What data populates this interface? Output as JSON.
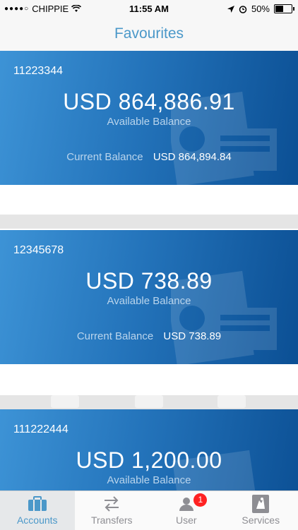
{
  "status_bar": {
    "carrier": "CHIPPIE",
    "time": "11:55 AM",
    "battery": "50%",
    "battery_level": 0.5
  },
  "nav": {
    "title": "Favourites"
  },
  "accounts": [
    {
      "number": "11223344",
      "available": "USD 864,886.91",
      "available_label": "Available Balance",
      "current_label": "Current Balance",
      "current": "USD 864,894.84"
    },
    {
      "number": "12345678",
      "available": "USD 738.89",
      "available_label": "Available Balance",
      "current_label": "Current Balance",
      "current": "USD 738.89"
    },
    {
      "number": "111222444",
      "available": "USD 1,200.00",
      "available_label": "Available Balance"
    }
  ],
  "tabs": [
    {
      "label": "Accounts",
      "icon": "briefcase-icon",
      "active": true
    },
    {
      "label": "Transfers",
      "icon": "transfer-arrows-icon"
    },
    {
      "label": "User",
      "icon": "user-icon",
      "badge": "1"
    },
    {
      "label": "Services",
      "icon": "services-icon"
    }
  ],
  "colors": {
    "accent": "#4b98c9",
    "card_start": "#3d93d6",
    "card_end": "#0b4f94",
    "badge": "#ff2222"
  }
}
